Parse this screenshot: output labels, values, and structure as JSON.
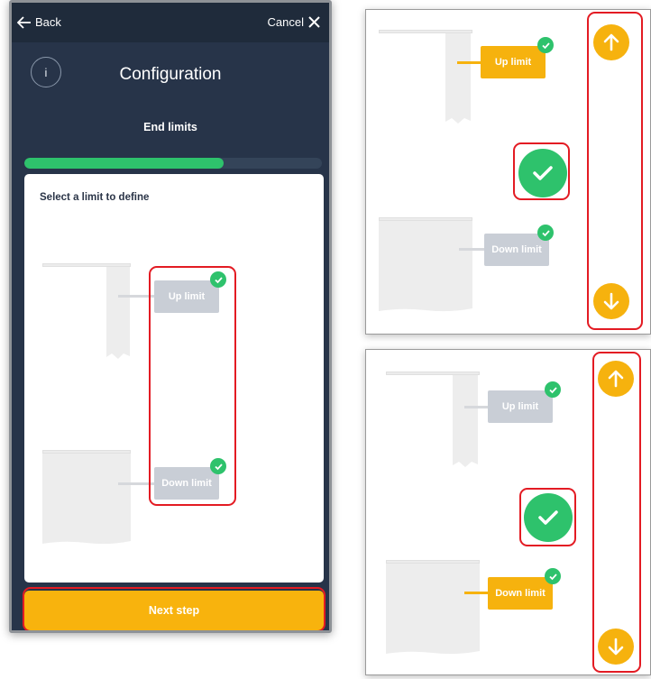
{
  "header": {
    "back_label": "Back",
    "cancel_label": "Cancel"
  },
  "info_button": {
    "label": "i"
  },
  "title": "Configuration",
  "subtitle": "End limits",
  "progress": {
    "fraction": 0.67
  },
  "card": {
    "title": "Select a limit to define"
  },
  "limits": {
    "up": "Up limit",
    "down": "Down limit"
  },
  "footer": {
    "next_label": "Next step"
  },
  "colors": {
    "primary": "#f6b20e",
    "success": "#2ec26c",
    "header_bg": "#273449",
    "inactive_button": "#c9ced6",
    "highlight": "#e31b23"
  },
  "icons": {
    "back": "arrow-left-icon",
    "cancel": "close-icon",
    "check": "checkmark-icon",
    "up": "arrow-up-icon",
    "down": "arrow-down-icon"
  },
  "zoom_panels": [
    {
      "active_limit": "up"
    },
    {
      "active_limit": "down"
    }
  ]
}
